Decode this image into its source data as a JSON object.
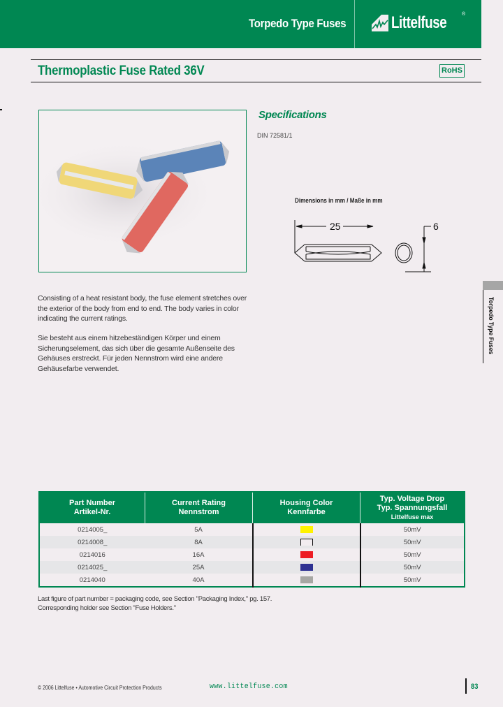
{
  "header": {
    "title": "Torpedo Type Fuses",
    "brand": "Littelfuse",
    "brand_registered": "®",
    "brand_color": "#008752"
  },
  "section": {
    "title": "Thermoplastic Fuse Rated 36V",
    "badge": "RoHS"
  },
  "photo": {
    "alt": "Torpedo fuses in yellow, blue and red",
    "fuses": [
      "yellow",
      "blue",
      "red"
    ]
  },
  "specifications": {
    "title": "Specifications",
    "standard": "DIN 72581/1",
    "dimensions_caption": "Dimensions in mm / Maße in mm",
    "length_label": "25",
    "diameter_label": "6"
  },
  "description": {
    "english": "Consisting of a heat resistant body, the fuse element stretches over the exterior of the body from end to end. The body varies in color indicating the current ratings.",
    "german": "Sie besteht aus einem hitzebeständigen Körper und einem Sicherungselement, das sich über die gesamte Außenseite des Gehäuses erstreckt. Für jeden Nennstrom wird eine andere Gehäusefarbe verwendet."
  },
  "side_tab": {
    "label": "Torpedo Type Fuses"
  },
  "table": {
    "headers": [
      {
        "line1": "Part Number",
        "line2": "Artikel-Nr.",
        "line3": ""
      },
      {
        "line1": "Current Rating",
        "line2": "Nennstrom",
        "line3": ""
      },
      {
        "line1": "Housing Color",
        "line2": "Kennfarbe",
        "line3": ""
      },
      {
        "line1": "Typ. Voltage Drop",
        "line2": "Typ. Spannungsfall",
        "line3": "Littelfuse max"
      }
    ],
    "rows": [
      {
        "part": "0214005_",
        "rating": "5A",
        "color_name": "yellow",
        "color": "#fff200",
        "drop": "50mV"
      },
      {
        "part": "0214008_",
        "rating": "8A",
        "color_name": "white",
        "color": "#f2edf0",
        "drop": "50mV"
      },
      {
        "part": "0214016",
        "rating": "16A",
        "color_name": "red",
        "color": "#ed1c24",
        "drop": "50mV"
      },
      {
        "part": "0214025_",
        "rating": "25A",
        "color_name": "blue",
        "color": "#2e3192",
        "drop": "50mV"
      },
      {
        "part": "0214040",
        "rating": "40A",
        "color_name": "grey",
        "color": "#a7a7a3",
        "drop": "50mV"
      }
    ]
  },
  "footnotes": [
    "Last figure of part number = packaging code, see Section \"Packaging Index,\" pg. 157.",
    "Corresponding holder see Section \"Fuse Holders.\""
  ],
  "footer": {
    "copyright": "© 2006 Littelfuse • Automotive Circuit Protection Products",
    "url": "www.littelfuse.com",
    "page_number": "83"
  }
}
